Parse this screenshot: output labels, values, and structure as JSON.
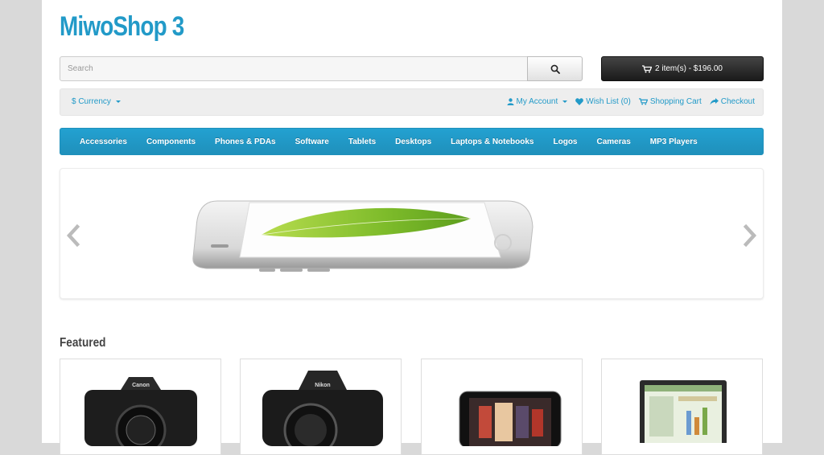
{
  "header": {
    "logo_text": "MiwoShop 3"
  },
  "search": {
    "placeholder": "Search",
    "button_icon": "search-icon"
  },
  "cart": {
    "icon": "shopping-cart-icon",
    "label": "2 item(s) - $196.00"
  },
  "topbar": {
    "currency_label": "$ Currency",
    "links": [
      {
        "icon": "user-icon",
        "label": "My Account"
      },
      {
        "icon": "heart-icon",
        "label": "Wish List (0)"
      },
      {
        "icon": "shopping-cart-icon",
        "label": "Shopping Cart"
      },
      {
        "icon": "share-icon",
        "label": "Checkout"
      }
    ]
  },
  "menu": {
    "items": [
      "Accessories",
      "Components",
      "Phones & PDAs",
      "Software",
      "Tablets",
      "Desktops",
      "Laptops & Notebooks",
      "Logos",
      "Cameras",
      "MP3 Players"
    ]
  },
  "slideshow": {
    "prev_icon": "chevron-left-icon",
    "next_icon": "chevron-right-icon",
    "image": "iphone-6-banner"
  },
  "featured": {
    "heading": "Featured",
    "products": [
      {
        "image": "canon-camera"
      },
      {
        "image": "nikon-camera"
      },
      {
        "image": "ipod-touch"
      },
      {
        "image": "monitor"
      }
    ]
  },
  "colors": {
    "brand": "#229ac8",
    "menu_bg": "#229ac8",
    "cart_bg": "#2b2b2b"
  }
}
